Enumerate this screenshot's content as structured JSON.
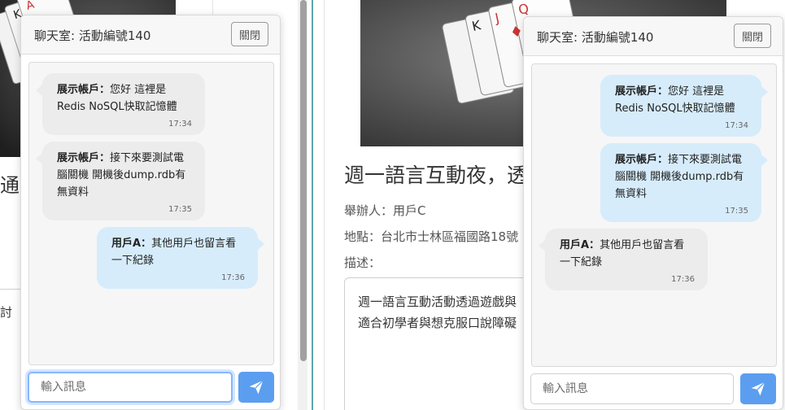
{
  "left_page": {
    "title_fragment": "通",
    "desc_fragment": "討"
  },
  "event": {
    "title": "週一語言互動夜，透",
    "organizer": "舉辦人：用戶C",
    "location": "地點：台北市士林區福國路18號",
    "desc_label": "描述：",
    "desc_line1": "週一語言互動活動透過遊戲與",
    "desc_line2": "適合初學者與想克服口說障礙"
  },
  "chat_left": {
    "title": "聊天室: 活動編號140",
    "close_label": "關閉",
    "input_placeholder": "輸入訊息",
    "messages": [
      {
        "sender": "展示帳戶：",
        "line1": "您好 這裡是",
        "line2": "Redis NoSQL快取記憶體",
        "line3": "",
        "time": "17:34"
      },
      {
        "sender": "展示帳戶：",
        "line1": "接下來要測試電",
        "line2": "腦關機 開機後dump.rdb有",
        "line3": "無資料",
        "time": "17:35"
      },
      {
        "sender": "用戶A：",
        "line1": "其他用戶也留言看",
        "line2": "一下紀錄",
        "line3": "",
        "time": "17:36"
      }
    ]
  },
  "chat_right": {
    "title": "聊天室: 活動編號140",
    "close_label": "關閉",
    "input_placeholder": "輸入訊息",
    "messages": [
      {
        "sender": "展示帳戶：",
        "line1": "您好 這裡是",
        "line2": "Redis NoSQL快取記憶體",
        "line3": "",
        "time": "17:34"
      },
      {
        "sender": "展示帳戶：",
        "line1": "接下來要測試電",
        "line2": "腦關機 開機後dump.rdb有",
        "line3": "無資料",
        "time": "17:35"
      },
      {
        "sender": "用戶A：",
        "line1": "其他用戶也留言看",
        "line2": "一下紀錄",
        "line3": "",
        "time": "17:36"
      }
    ]
  },
  "colors": {
    "sent_bubble": "#d6ecfb",
    "received_bubble": "#ececec",
    "send_button": "#5b9ef0"
  },
  "icons": {
    "send": "paper-plane-icon",
    "image": "playing-cards-photo"
  }
}
